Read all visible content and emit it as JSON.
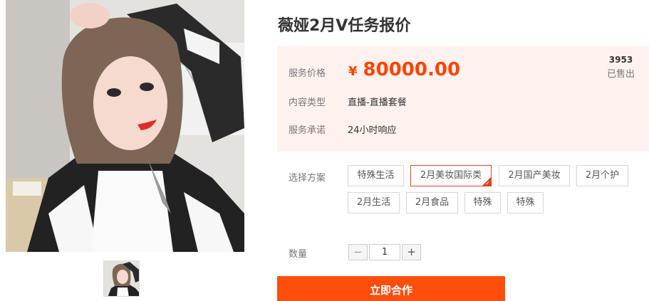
{
  "product": {
    "title": "薇娅2月V任务报价",
    "image": "portrait-photo"
  },
  "price_box": {
    "price_label": "服务价格",
    "currency": "¥",
    "price": "80000.00",
    "sold_count": "3953",
    "sold_label": "已售出",
    "type_label": "内容类型",
    "type_value": "直播-直播套餐",
    "promise_label": "服务承诺",
    "promise_value": "24小时响应"
  },
  "plans": {
    "label": "选择方案",
    "selected_index": 1,
    "options": [
      "特殊生活",
      "2月美妆国际类",
      "2月国产美妆",
      "2月个护",
      "2月生活",
      "2月食品",
      "特殊",
      "特殊"
    ]
  },
  "quantity": {
    "label": "数量",
    "minus": "−",
    "plus": "+",
    "value": "1"
  },
  "cta": {
    "label": "立即合作"
  },
  "colors": {
    "accent": "#ff4400",
    "button": "#ff4e0c",
    "price_bg": "#fff2ee",
    "selected_border": "#e0411a"
  }
}
